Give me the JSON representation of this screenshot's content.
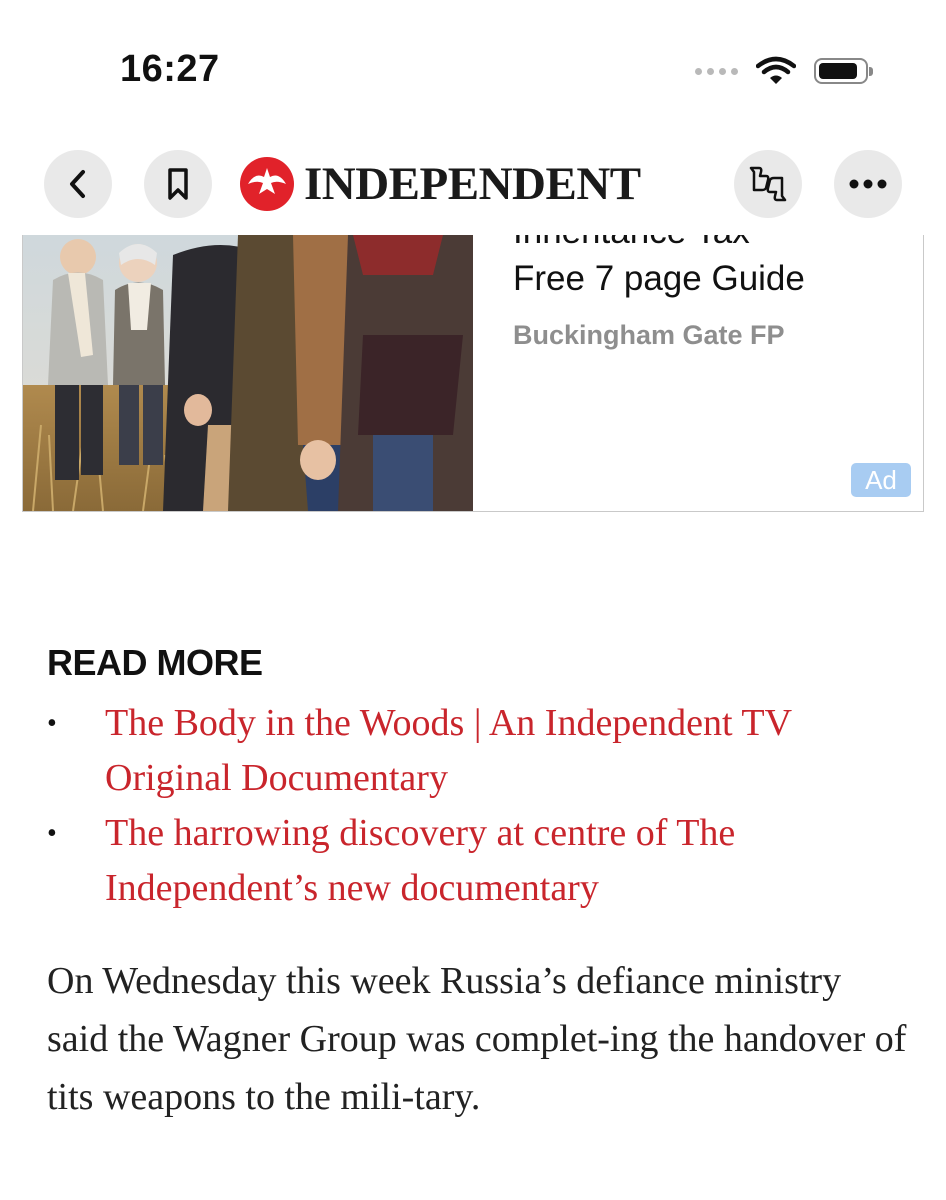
{
  "status_bar": {
    "time": "16:27"
  },
  "nav": {
    "back_icon": "chevron-left-icon",
    "bookmark_icon": "bookmark-icon",
    "logo_text": "INDEPENDENT",
    "feedback_icon": "thumbs-feedback-icon",
    "more_icon": "ellipsis-icon"
  },
  "ad": {
    "title_line1_partial": "Inheritance Tax -",
    "title_line2": "Free 7 page Guide",
    "source": "Buckingham Gate FP",
    "badge": "Ad"
  },
  "read_more": {
    "heading": "READ MORE",
    "items": [
      {
        "text": "The Body in the Woods | An Independent TV Original Documentary"
      },
      {
        "text": "The harrowing discovery at centre of The Independent’s new documentary"
      }
    ]
  },
  "article": {
    "paragraph": "On Wednesday this week Russia’s defiance ministry said the Wagner Group was complet-ing the handover of tits weapons to the mili-tary."
  },
  "colors": {
    "link_red": "#c9252c",
    "logo_red": "#e1222a",
    "ad_badge_blue": "#a8ccf2"
  }
}
